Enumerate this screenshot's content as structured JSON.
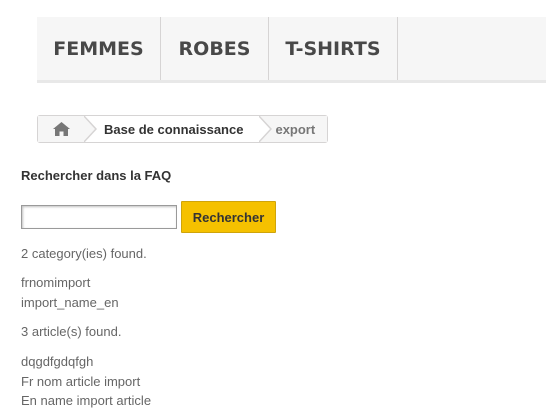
{
  "nav": {
    "items": [
      "FEMMES",
      "ROBES",
      "T-SHIRTS"
    ]
  },
  "breadcrumb": {
    "home_icon": "home-icon",
    "link": "Base de connaissance",
    "current": "export"
  },
  "search": {
    "title": "Rechercher dans la FAQ",
    "input_value": "",
    "button_label": "Rechercher"
  },
  "results": {
    "categories_summary": "2 category(ies) found.",
    "categories": [
      "frnomimport",
      "import_name_en"
    ],
    "articles_summary": "3 article(s) found.",
    "articles": [
      "dqgdfgdqfgh",
      "Fr nom article import",
      "En name import article"
    ]
  },
  "colors": {
    "button": "#f5c100",
    "nav_background": "#f6f6f6",
    "text": "#333333"
  }
}
